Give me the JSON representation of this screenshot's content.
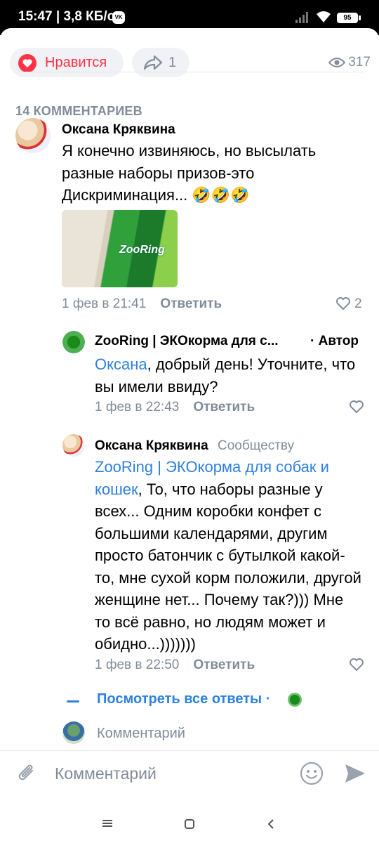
{
  "status_bar": {
    "time": "15:47 | 3,8 КБ/с",
    "app_badge": "VK",
    "battery": "95"
  },
  "actions": {
    "like_label": "Нравится",
    "share_count": "1",
    "views": "317"
  },
  "comments_header": "14 КОММЕНТАРИЕВ",
  "comments": [
    {
      "author": "Оксана Кряквина",
      "text": "Я конечно извиняюсь, но высылать разные наборы призов-это Дискриминация... 🤣🤣🤣",
      "date": "1 фев в 21:41",
      "reply_label": "Ответить",
      "likes": "2",
      "photo_brand": "ZooRing"
    }
  ],
  "replies": [
    {
      "author": "ZooRing | ЭКОкорма для с...",
      "tag": "· Автор",
      "mention": "Оксана",
      "text": ", добрый день! Уточните, что вы имели ввиду?",
      "date": "1 фев в 22:43",
      "reply_label": "Ответить"
    },
    {
      "author": "Оксана Кряквина",
      "tag": "Сообществу",
      "mention": "ZooRing | ЭКОкорма для собак и кошек",
      "text": ", То, что наборы разные у всех... Одним коробки конфет с большими календарями, другим просто батончик с бутылкой какой-то, мне сухой корм положили, другой женщине нет... Почему так?))) Мне то всё равно, но людям может и обидно...)))))))",
      "date": "1 фев в 22:50",
      "reply_label": "Ответить"
    }
  ],
  "show_all_replies": "Посмотреть все ответы ·",
  "inline_comment_placeholder": "Комментарий",
  "composer": {
    "placeholder": "Комментарий"
  },
  "colors": {
    "accent": "#2d81e0",
    "like_red": "#ff3347",
    "muted": "#818c99"
  }
}
